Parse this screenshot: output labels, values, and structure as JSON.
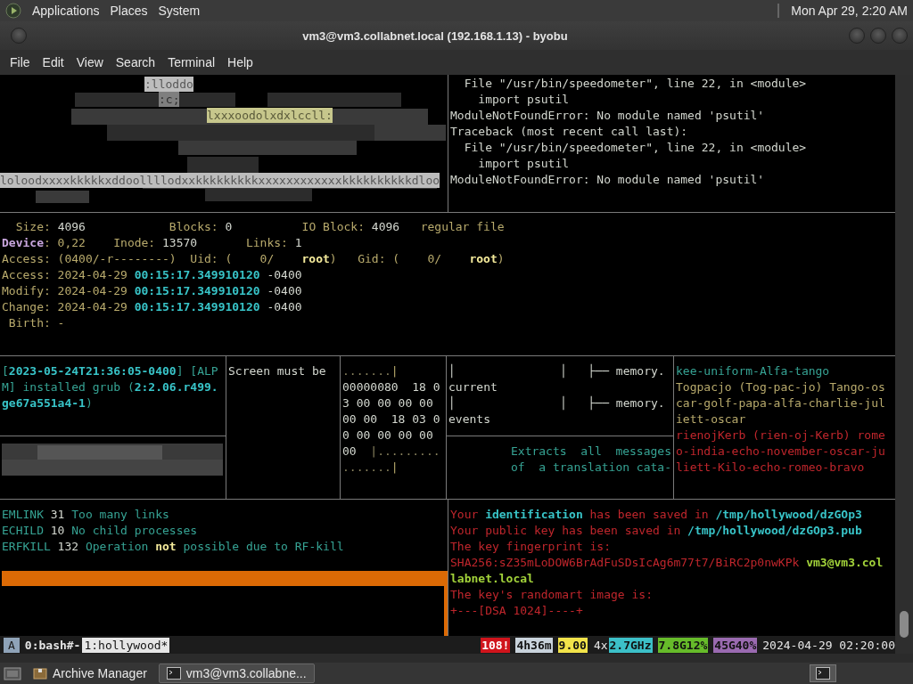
{
  "top_panel": {
    "menus": [
      "Applications",
      "Places",
      "System"
    ],
    "clock": "Mon Apr 29,  2:20 AM"
  },
  "window": {
    "title": "vm3@vm3.collabnet.local (192.168.1.13) - byobu"
  },
  "menu_bar": [
    "File",
    "Edit",
    "View",
    "Search",
    "Terminal",
    "Help"
  ],
  "panes": {
    "art": {
      "snippets": [
        {
          "text": ":lloddo",
          "kind": "light"
        },
        {
          "text": ":c;",
          "kind": "mid"
        },
        {
          "text": "lxxxoodolxdxlccll:",
          "kind": "tinted"
        },
        {
          "text": "loloodxxxxkkkkkxddoollllodxxkkkkkkkkkxxxxxxxxxxxxkkkkkkkkkkdloo",
          "kind": "light"
        }
      ]
    },
    "traceback": {
      "lines": [
        [
          {
            "text": "  File \"/usr/bin/speedometer\", line 22, in <module>",
            "kind": "plain"
          }
        ],
        [
          {
            "text": "    import psutil",
            "kind": "plain"
          }
        ],
        [
          {
            "text": "ModuleNotFoundError: No module named 'psutil'",
            "kind": "plain"
          }
        ],
        [
          {
            "text": "Traceback (most recent call last):",
            "kind": "plain"
          }
        ],
        [
          {
            "text": "  File \"/usr/bin/speedometer\", line 22, in <module>",
            "kind": "plain"
          }
        ],
        [
          {
            "text": "    import psutil",
            "kind": "plain"
          }
        ],
        [
          {
            "text": "ModuleNotFoundError: No module named 'psutil'",
            "kind": "plain"
          }
        ]
      ]
    },
    "file_stat": {
      "lines": [
        [
          {
            "text": "  Size: ",
            "kind": "field"
          },
          {
            "text": "4096",
            "kind": "plain"
          },
          {
            "text": "            Blocks: ",
            "kind": "field"
          },
          {
            "text": "0",
            "kind": "plain"
          },
          {
            "text": "          IO Block: ",
            "kind": "field"
          },
          {
            "text": "4096",
            "kind": "plain"
          },
          {
            "text": "   regular file",
            "kind": "field"
          }
        ],
        [
          {
            "text": "Device",
            "kind": "device"
          },
          {
            "text": ": 0,22    Inode: ",
            "kind": "field"
          },
          {
            "text": "13570",
            "kind": "plain"
          },
          {
            "text": "       Links: ",
            "kind": "field"
          },
          {
            "text": "1",
            "kind": "plain"
          }
        ],
        [
          {
            "text": "Access: (0400/-r--------)  Uid: (    0/    ",
            "kind": "field"
          },
          {
            "text": "root",
            "kind": "strong"
          },
          {
            "text": ")   Gid: (    0/    ",
            "kind": "field"
          },
          {
            "text": "root",
            "kind": "strong"
          },
          {
            "text": ")",
            "kind": "field"
          }
        ],
        [
          {
            "text": "Access: 2024-04-29 ",
            "kind": "field"
          },
          {
            "text": "00:15:17.349910120",
            "kind": "accent"
          },
          {
            "text": " -0400",
            "kind": "plain"
          }
        ],
        [
          {
            "text": "Modify: 2024-04-29 ",
            "kind": "field"
          },
          {
            "text": "00:15:17.349910120",
            "kind": "accent"
          },
          {
            "text": " -0400",
            "kind": "plain"
          }
        ],
        [
          {
            "text": "Change: 2024-04-29 ",
            "kind": "field"
          },
          {
            "text": "00:15:17.349910120",
            "kind": "accent"
          },
          {
            "text": " -0400",
            "kind": "plain"
          }
        ],
        [
          {
            "text": " Birth: -",
            "kind": "field"
          }
        ]
      ]
    },
    "package_log": {
      "lines": [
        [
          {
            "text": "[",
            "kind": "info"
          },
          {
            "text": "2023-05-24T21:36:05-0400",
            "kind": "accent"
          },
          {
            "text": "] [ALPM] installed grub (",
            "kind": "info"
          },
          {
            "text": "2:2.06.r499.ge67a551a4-1",
            "kind": "accent"
          },
          {
            "text": ")",
            "kind": "info"
          }
        ]
      ]
    },
    "message": {
      "lines": [
        [
          {
            "text": "Screen must be",
            "kind": "plain"
          }
        ]
      ]
    },
    "hex_dump": {
      "lines": [
        [
          {
            "text": ".......",
            "kind": "dim"
          },
          {
            "text": "|",
            "kind": "field"
          }
        ],
        [
          {
            "text": "00000080  18 0",
            "kind": "plain"
          }
        ],
        [
          {
            "text": "3 00 00 00 00",
            "kind": "plain"
          }
        ],
        [
          {
            "text": "00 00  18 03 0",
            "kind": "plain"
          }
        ],
        [
          {
            "text": "0 00 00 00 00",
            "kind": "plain"
          }
        ],
        [
          {
            "text": "00  ",
            "kind": "plain"
          },
          {
            "text": "|.........",
            "kind": "dim"
          }
        ],
        [
          {
            "text": ".......",
            "kind": "dim"
          },
          {
            "text": "|",
            "kind": "field"
          }
        ]
      ]
    },
    "tree": {
      "lines": [
        [
          {
            "text": "│               │   ├── memory.",
            "kind": "plain"
          }
        ],
        [
          {
            "text": "current",
            "kind": "plain"
          }
        ],
        [
          {
            "text": "│               │   ├── memory.",
            "kind": "plain"
          }
        ],
        [
          {
            "text": "events",
            "kind": "plain"
          }
        ]
      ]
    },
    "man_page": {
      "lines": [
        [
          {
            "text": "      Extracts  all  messages",
            "kind": "info"
          }
        ],
        [
          {
            "text": "      of  a translation cata-",
            "kind": "info"
          }
        ]
      ]
    },
    "phonetic": {
      "lines": [
        [
          {
            "text": "kee-uniform-Alfa-tango",
            "kind": "info"
          }
        ],
        [
          {
            "text": "Togpacjo (Tog-pac-jo) Tango-oscar-golf-papa-alfa-charlie-juliett-oscar",
            "kind": "field"
          }
        ],
        [
          {
            "text": "rienojKerb (rien-oj-Kerb) romeo-india-echo-november-oscar-juliett-Kilo-echo-romeo-bravo",
            "kind": "error"
          }
        ]
      ]
    },
    "errno": {
      "lines": [
        [
          {
            "text": "EMLINK",
            "kind": "info"
          },
          {
            "text": " 31 ",
            "kind": "plain"
          },
          {
            "text": "Too many links",
            "kind": "info"
          }
        ],
        [
          {
            "text": "ECHILD",
            "kind": "info"
          },
          {
            "text": " 10 ",
            "kind": "plain"
          },
          {
            "text": "No child processes",
            "kind": "info"
          }
        ],
        [
          {
            "text": "ERFKILL",
            "kind": "info"
          },
          {
            "text": " 132 ",
            "kind": "plain"
          },
          {
            "text": "Operation ",
            "kind": "info"
          },
          {
            "text": "not",
            "kind": "strong"
          },
          {
            "text": " possible due to RF-kill",
            "kind": "info"
          }
        ]
      ]
    },
    "key_gen": {
      "lines": [
        [
          {
            "text": "Your ",
            "kind": "error"
          },
          {
            "text": "identification",
            "kind": "accent"
          },
          {
            "text": " has been saved in ",
            "kind": "error"
          },
          {
            "text": "/tmp/hollywood/dzGOp3",
            "kind": "accent"
          }
        ],
        [
          {
            "text": "Your public key has been saved in ",
            "kind": "error"
          },
          {
            "text": "/tmp/hollywood/dzGOp3.pub",
            "kind": "accent"
          }
        ],
        [
          {
            "text": "The key fingerprint is:",
            "kind": "error"
          }
        ],
        [
          {
            "text": "SHA256:sZ35mLoDOW6BrAdFuSDsIcAg6m77t7/BiRC2p0nwKPk ",
            "kind": "error"
          },
          {
            "text": "vm3@vm3.collabnet.local",
            "kind": "host"
          }
        ],
        [
          {
            "text": "The key's randomart image is:",
            "kind": "error"
          }
        ],
        [
          {
            "text": "+---[DSA 1024]----+",
            "kind": "error"
          }
        ]
      ]
    }
  },
  "status_bar": {
    "session": "A",
    "windows": [
      {
        "label": "0:bash#-",
        "selected": false
      },
      {
        "label": "1:hollywood*",
        "selected": true
      }
    ],
    "indicators": [
      {
        "text": "108!",
        "kind": "badge",
        "color": "#d0141c"
      },
      {
        "text": "4h36m",
        "kind": "badge",
        "color": "#c9d3dc"
      },
      {
        "text": "9.00",
        "kind": "badge",
        "color": "#f2e34a"
      },
      {
        "text": "4x",
        "kind": "plain"
      },
      {
        "text": "2.7GHz",
        "kind": "badge",
        "color": "#3cc0c8"
      },
      {
        "text": "7.8G12%",
        "kind": "badge",
        "color": "#66bb2a"
      },
      {
        "text": "45G40%",
        "kind": "badge",
        "color": "#9a6ab0"
      }
    ],
    "datetime": "2024-04-29 02:20:00"
  },
  "taskbar": {
    "tasks": [
      {
        "label": "Archive Manager",
        "selected": false
      },
      {
        "label": "vm3@vm3.collabne...",
        "selected": true
      }
    ]
  }
}
